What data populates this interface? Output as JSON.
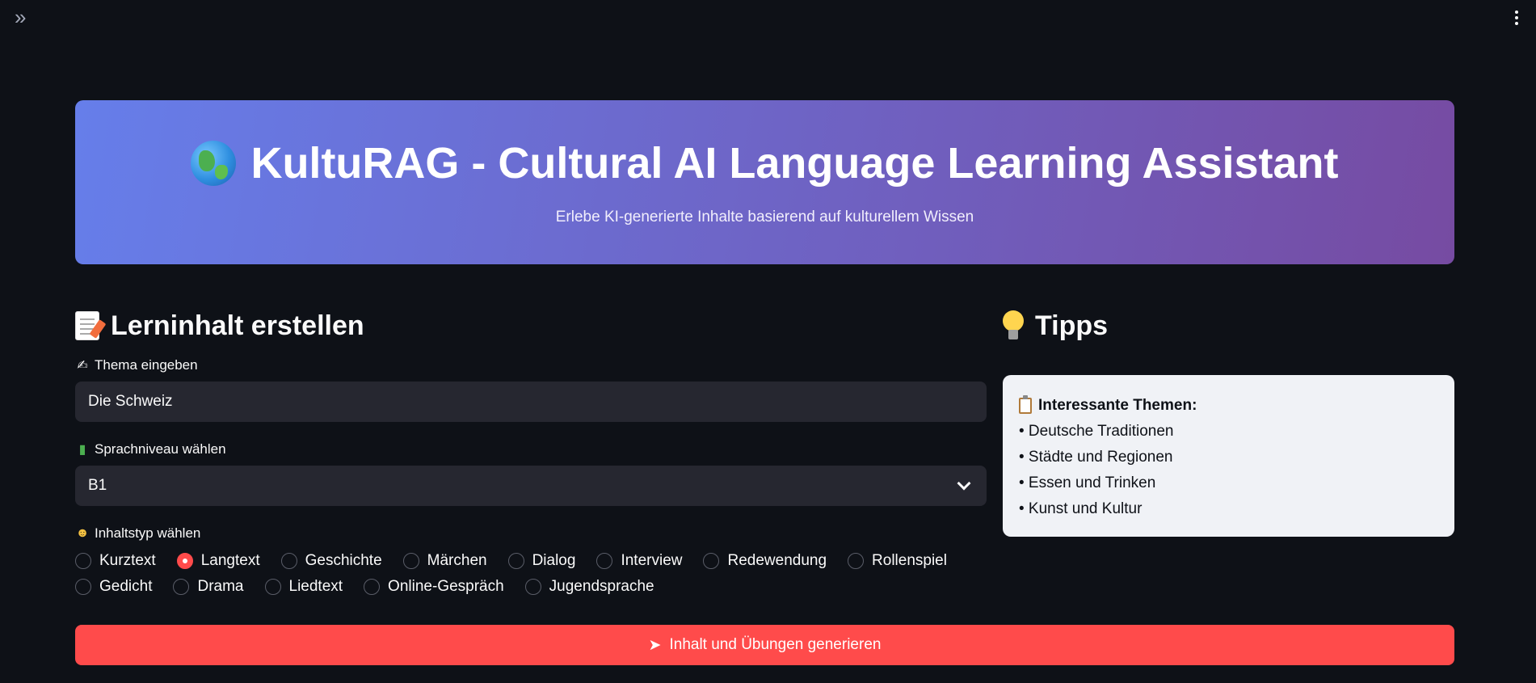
{
  "topbar": {
    "sidebar_toggle_icon": "double-chevron-right-icon",
    "menu_icon": "vertical-dots-icon"
  },
  "hero": {
    "icon": "globe-icon",
    "title": "KultuRAG - Cultural AI Language Learning Assistant",
    "subtitle": "Erlebe KI-generierte Inhalte basierend auf kulturellem Wissen",
    "gradient_start": "#667eea",
    "gradient_end": "#764ba2"
  },
  "create": {
    "heading": "Lerninhalt erstellen",
    "heading_icon": "document-pencil-icon",
    "topic_label": "Thema eingeben",
    "topic_value": "Die Schweiz",
    "level_label": "Sprachniveau wählen",
    "level_value": "B1",
    "type_label": "Inhaltstyp wählen",
    "content_types_row1": [
      "Kurztext",
      "Langtext",
      "Geschichte",
      "Märchen",
      "Dialog",
      "Interview",
      "Redewendung",
      "Rollenspiel"
    ],
    "content_types_row2": [
      "Gedicht",
      "Drama",
      "Liedtext",
      "Online-Gespräch",
      "Jugendsprache"
    ],
    "selected_type": "Langtext"
  },
  "tips": {
    "heading": "Tipps",
    "heading_icon": "lightbulb-icon",
    "box_title": "Interessante Themen:",
    "items": [
      "• Deutsche Traditionen",
      "• Städte und Regionen",
      "• Essen und Trinken",
      "• Kunst und Kultur"
    ]
  },
  "generate_button": {
    "label": "Inhalt und Übungen generieren",
    "icon": "rocket-icon",
    "color": "#ff4b4b"
  }
}
